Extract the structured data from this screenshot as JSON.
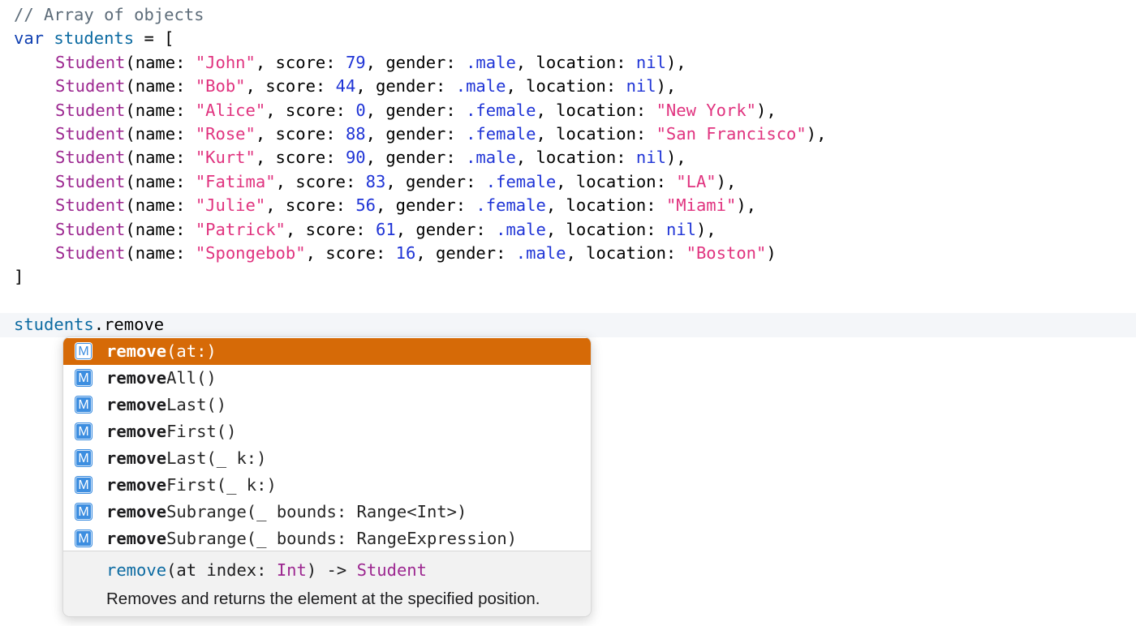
{
  "code": {
    "comment": "// Array of objects",
    "decl": {
      "keyword": "var",
      "name": "students",
      "rest": " = ["
    },
    "students": [
      {
        "name": "\"John\"",
        "score": "79",
        "gender": ".male",
        "location": "nil"
      },
      {
        "name": "\"Bob\"",
        "score": "44",
        "gender": ".male",
        "location": "nil"
      },
      {
        "name": "\"Alice\"",
        "score": "0",
        "gender": ".female",
        "location": "\"New York\""
      },
      {
        "name": "\"Rose\"",
        "score": "88",
        "gender": ".female",
        "location": "\"San Francisco\""
      },
      {
        "name": "\"Kurt\"",
        "score": "90",
        "gender": ".male",
        "location": "nil"
      },
      {
        "name": "\"Fatima\"",
        "score": "83",
        "gender": ".female",
        "location": "\"LA\""
      },
      {
        "name": "\"Julie\"",
        "score": "56",
        "gender": ".female",
        "location": "\"Miami\""
      },
      {
        "name": "\"Patrick\"",
        "score": "61",
        "gender": ".male",
        "location": "nil"
      },
      {
        "name": "\"Spongebob\"",
        "score": "16",
        "gender": ".male",
        "location": "\"Boston\""
      }
    ],
    "tokens": {
      "type": "Student",
      "name_label": "(name: ",
      "score_label": ", score: ",
      "gender_label": ", gender: ",
      "location_label": ", location: ",
      "row_end": "),",
      "last_row_end": ")"
    },
    "close": "]",
    "current_line": {
      "object": "students",
      "dot": ".",
      "typed": "remove"
    }
  },
  "autocomplete": {
    "badge": "M",
    "selected_index": 0,
    "items": [
      {
        "bold": "remove",
        "rest": "(at:)"
      },
      {
        "bold": "remove",
        "rest": "All()"
      },
      {
        "bold": "remove",
        "rest": "Last()"
      },
      {
        "bold": "remove",
        "rest": "First()"
      },
      {
        "bold": "remove",
        "rest": "Last(_ k:)"
      },
      {
        "bold": "remove",
        "rest": "First(_ k:)"
      },
      {
        "bold": "remove",
        "rest": "Subrange(_ bounds: Range<Int>)"
      },
      {
        "bold": "remove",
        "rest": "Subrange(_ bounds: RangeExpression)"
      }
    ],
    "detail": {
      "signature_func": "remove",
      "signature_mid": "(at index: ",
      "signature_type": "Int",
      "signature_arrow": ") -> ",
      "signature_return": "Student",
      "description": "Removes and returns the element at the specified position."
    }
  },
  "colors": {
    "selection": "#d66a07",
    "badge": "#3d8ee0",
    "string": "#e0337f",
    "number": "#1f34d6",
    "type": "#9c2790"
  }
}
